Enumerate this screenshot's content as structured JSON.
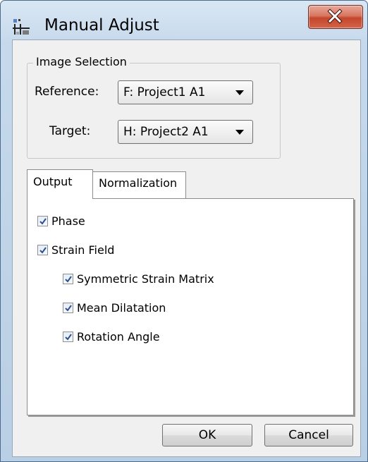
{
  "window": {
    "title": "Manual Adjust",
    "icon": "app-icon",
    "close_icon": "close-icon"
  },
  "image_selection": {
    "legend": "Image Selection",
    "reference_label": "Reference:",
    "reference_value": "F: Project1 A1",
    "target_label": "Target:",
    "target_value": "H: Project2 A1"
  },
  "tabs": [
    {
      "label": "Output",
      "selected": true
    },
    {
      "label": "Normalization",
      "selected": false
    }
  ],
  "output": {
    "phase": {
      "label": "Phase",
      "checked": true
    },
    "strain_field": {
      "label": "Strain Field",
      "checked": true
    },
    "symmetric_strain_matrix": {
      "label": "Symmetric Strain Matrix",
      "checked": true
    },
    "mean_dilatation": {
      "label": "Mean Dilatation",
      "checked": true
    },
    "rotation_angle": {
      "label": "Rotation Angle",
      "checked": true
    }
  },
  "buttons": {
    "ok": "OK",
    "cancel": "Cancel"
  },
  "colors": {
    "titlebar": "#c6d9ec",
    "close_button": "#c4452c",
    "dialog_bg": "#f0f0f0"
  }
}
